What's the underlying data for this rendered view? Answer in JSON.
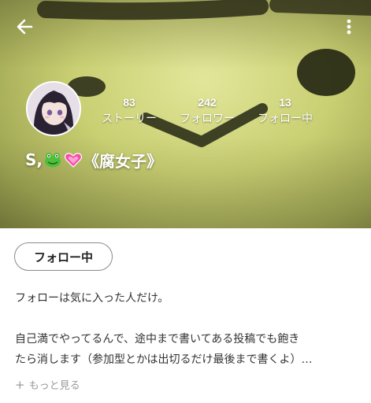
{
  "header": {
    "back_icon": "arrow-left-icon",
    "menu_icon": "more-vertical-icon",
    "cover_tint": "#c9cf72"
  },
  "profile": {
    "display_name_prefix": "S,",
    "display_name_emojis": [
      "frog-emoji",
      "sparkling-heart-emoji"
    ],
    "display_name_suffix": "《腐女子》"
  },
  "stats": [
    {
      "count": "83",
      "label": "ストーリー"
    },
    {
      "count": "242",
      "label": "フォロワー"
    },
    {
      "count": "13",
      "label": "フォロー中"
    }
  ],
  "follow_button": {
    "label": "フォロー中"
  },
  "bio": {
    "lines": [
      "フォローは気に入った人だけ。",
      "",
      "自己満でやってるんで、途中まで書いてある投稿でも飽き",
      "たら消します（参加型とかは出切るだけ最後まで書くよ）…"
    ],
    "more_label": "もっと見る",
    "more_icon": "plus-icon"
  }
}
